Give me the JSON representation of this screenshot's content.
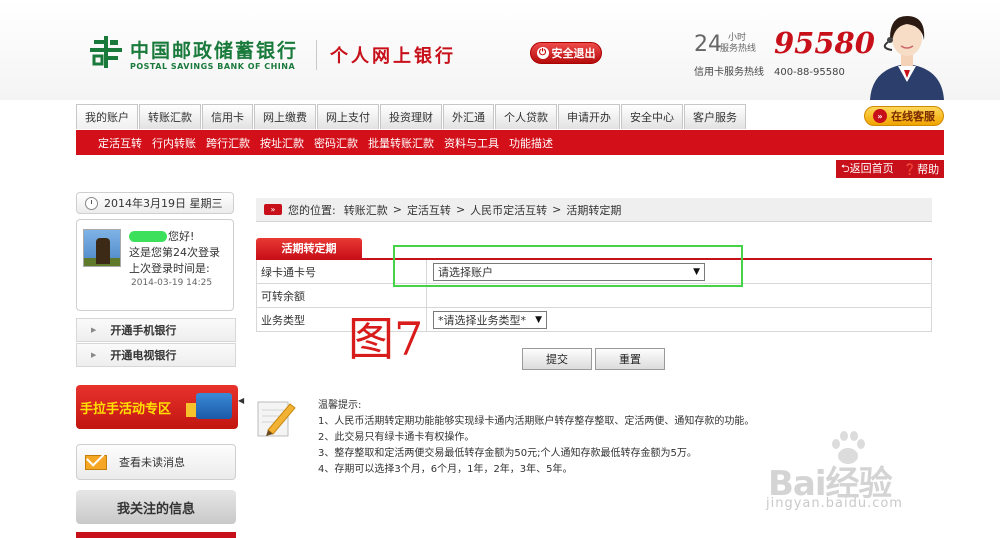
{
  "header": {
    "bank_name_cn": "中国邮政储蓄银行",
    "bank_name_en": "POSTAL SAVINGS BANK OF CHINA",
    "product_name": "个人网上银行",
    "logout_label": "安全退出",
    "hotline_24": "24",
    "hotline_hours": "小时",
    "hotline_service": "服务热线",
    "hotline_number": "95580",
    "credit_hotline": "信用卡服务热线　400-88-95580"
  },
  "main_nav": {
    "items": [
      "我的账户",
      "转账汇款",
      "信用卡",
      "网上缴费",
      "网上支付",
      "投资理财",
      "外汇通",
      "个人贷款",
      "申请开办",
      "安全中心",
      "客户服务"
    ],
    "online_service": "在线客服"
  },
  "sub_nav": {
    "items": [
      "定活互转",
      "行内转账",
      "跨行汇款",
      "按址汇款",
      "密码汇款",
      "批量转账汇款",
      "资料与工具",
      "功能描述"
    ]
  },
  "top_links": {
    "home": "返回首页",
    "help": "帮助"
  },
  "sidebar": {
    "date": "2014年3月19日  星期三",
    "greeting_suffix": "您好!",
    "login_count": "这是您第24次登录",
    "last_login_label": "上次登录时间是:",
    "last_login_time": "2014-03-19 14:25",
    "links": [
      "开通手机银行",
      "开通电视银行"
    ],
    "promo": "手拉手活动专区",
    "unread": "查看未读消息",
    "follow": "我关注的信息"
  },
  "breadcrumb": {
    "label": "您的位置:",
    "path": [
      "转账汇款",
      "定活互转",
      "人民币定活互转",
      "活期转定期"
    ]
  },
  "form": {
    "tab": "活期转定期",
    "rows": [
      {
        "label": "绿卡通卡号",
        "value": "请选择账户"
      },
      {
        "label": "可转余额",
        "value": ""
      },
      {
        "label": "业务类型",
        "value": "*请选择业务类型*"
      }
    ],
    "submit": "提交",
    "reset": "重置"
  },
  "figure_label": "图7",
  "tips": {
    "title": "温馨提示:",
    "items": [
      "1、人民币活期转定期功能能够实现绿卡通内活期账户转存整存整取、定活两便、通知存款的功能。",
      "2、此交易只有绿卡通卡有权操作。",
      "3、整存整取和定活两便交易最低转存金额为50元;个人通知存款最低转存金额为5万。",
      "4、存期可以选择3个月，6个月，1年，2年，3年、5年。"
    ]
  },
  "watermark": {
    "logo": "Bai经验",
    "url": "jingyan.baidu.com"
  },
  "colors": {
    "brand_red": "#c8101a",
    "brand_green": "#1a7a3c",
    "highlight_green": "#47d347"
  }
}
